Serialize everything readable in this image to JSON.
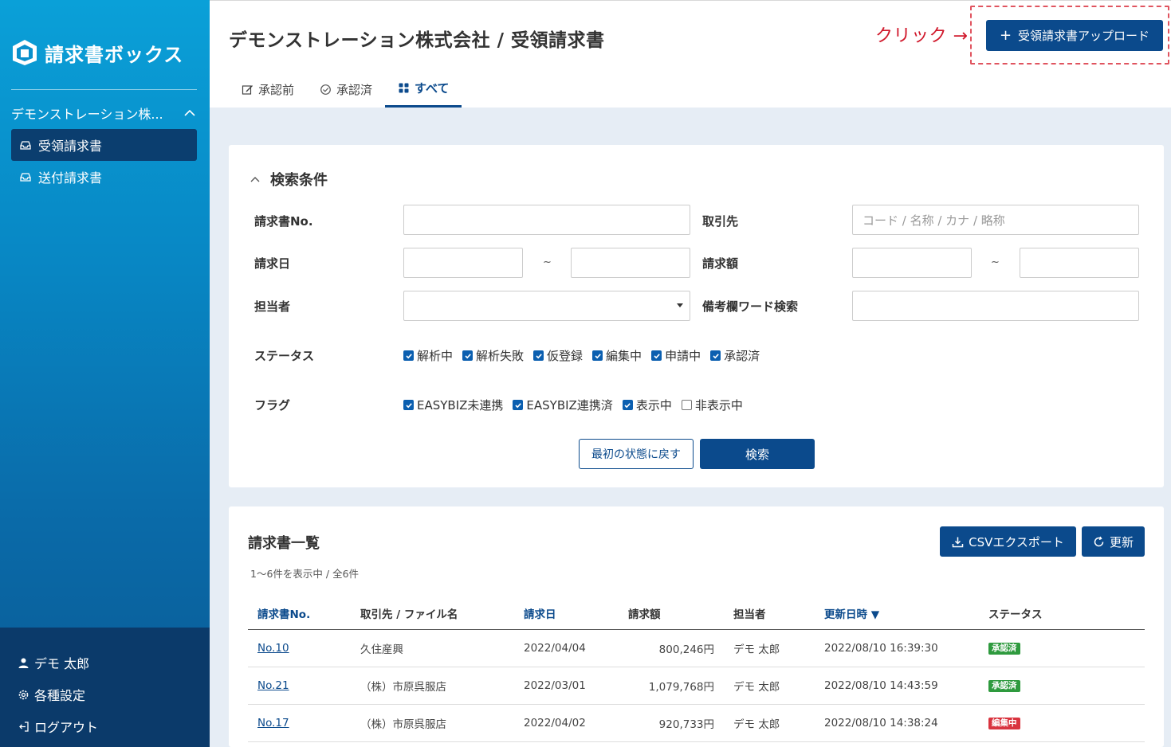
{
  "sidebar": {
    "logo_text": "請求書ボックス",
    "company": "デモンストレーション株...",
    "items": [
      {
        "label": "受領請求書",
        "icon": "inbox-icon"
      },
      {
        "label": "送付請求書",
        "icon": "inbox-icon"
      }
    ],
    "bottom": [
      {
        "label": "デモ 太郎",
        "icon": "user-icon"
      },
      {
        "label": "各種設定",
        "icon": "gear-icon"
      },
      {
        "label": "ログアウト",
        "icon": "logout-icon"
      }
    ]
  },
  "header": {
    "title": "デモンストレーション株式会社 / 受領請求書",
    "tabs": [
      {
        "label": "承認前",
        "icon": "edit-icon"
      },
      {
        "label": "承認済",
        "icon": "check-circle-icon"
      },
      {
        "label": "すべて",
        "icon": "grid-icon"
      }
    ],
    "click_note": "クリック →",
    "upload_label": "受領請求書アップロード",
    "upload_plus": "+"
  },
  "search": {
    "title": "検索条件",
    "labels": {
      "invoice_no": "請求書No.",
      "partner": "取引先",
      "invoice_date": "請求日",
      "amount": "請求額",
      "person": "担当者",
      "remarks": "備考欄ワード検索",
      "status": "ステータス",
      "flag": "フラグ"
    },
    "partner_placeholder": "コード / 名称 / カナ / 略称",
    "tilde": "~",
    "status_options": [
      {
        "label": "解析中",
        "checked": true
      },
      {
        "label": "解析失敗",
        "checked": true
      },
      {
        "label": "仮登録",
        "checked": true
      },
      {
        "label": "編集中",
        "checked": true
      },
      {
        "label": "申請中",
        "checked": true
      },
      {
        "label": "承認済",
        "checked": true
      }
    ],
    "flag_options": [
      {
        "label": "EASYBIZ未連携",
        "checked": true
      },
      {
        "label": "EASYBIZ連携済",
        "checked": true
      },
      {
        "label": "表示中",
        "checked": true
      },
      {
        "label": "非表示中",
        "checked": false
      }
    ],
    "reset_label": "最初の状態に戻す",
    "search_label": "検索"
  },
  "list": {
    "title": "請求書一覧",
    "count": "1〜6件を表示中 / 全6件",
    "csv_label": "CSVエクスポート",
    "refresh_label": "更新",
    "columns": [
      "請求書No.",
      "取引先 / ファイル名",
      "請求日",
      "請求額",
      "担当者",
      "更新日時 ▼",
      "ステータス"
    ],
    "rows": [
      {
        "no": "No.10",
        "partner": "久住産興",
        "date": "2022/04/04",
        "amount": "800,246円",
        "person": "デモ 太郎",
        "updated": "2022/08/10 16:39:30",
        "status": "承認済",
        "status_color": "#2e9a3e"
      },
      {
        "no": "No.21",
        "partner": "（株）市原呉服店",
        "date": "2022/03/01",
        "amount": "1,079,768円",
        "person": "デモ 太郎",
        "updated": "2022/08/10 14:43:59",
        "status": "承認済",
        "status_color": "#2e9a3e"
      },
      {
        "no": "No.17",
        "partner": "（株）市原呉服店",
        "date": "2022/04/02",
        "amount": "920,733円",
        "person": "デモ 太郎",
        "updated": "2022/08/10 14:38:24",
        "status": "編集中",
        "status_color": "#d9343f"
      }
    ]
  },
  "colors": {
    "primary": "#0b4a8c",
    "sidebar_top": "#0aa0d8",
    "sidebar_bottom": "#0b3a6a",
    "annotation_red": "#d0182b"
  }
}
